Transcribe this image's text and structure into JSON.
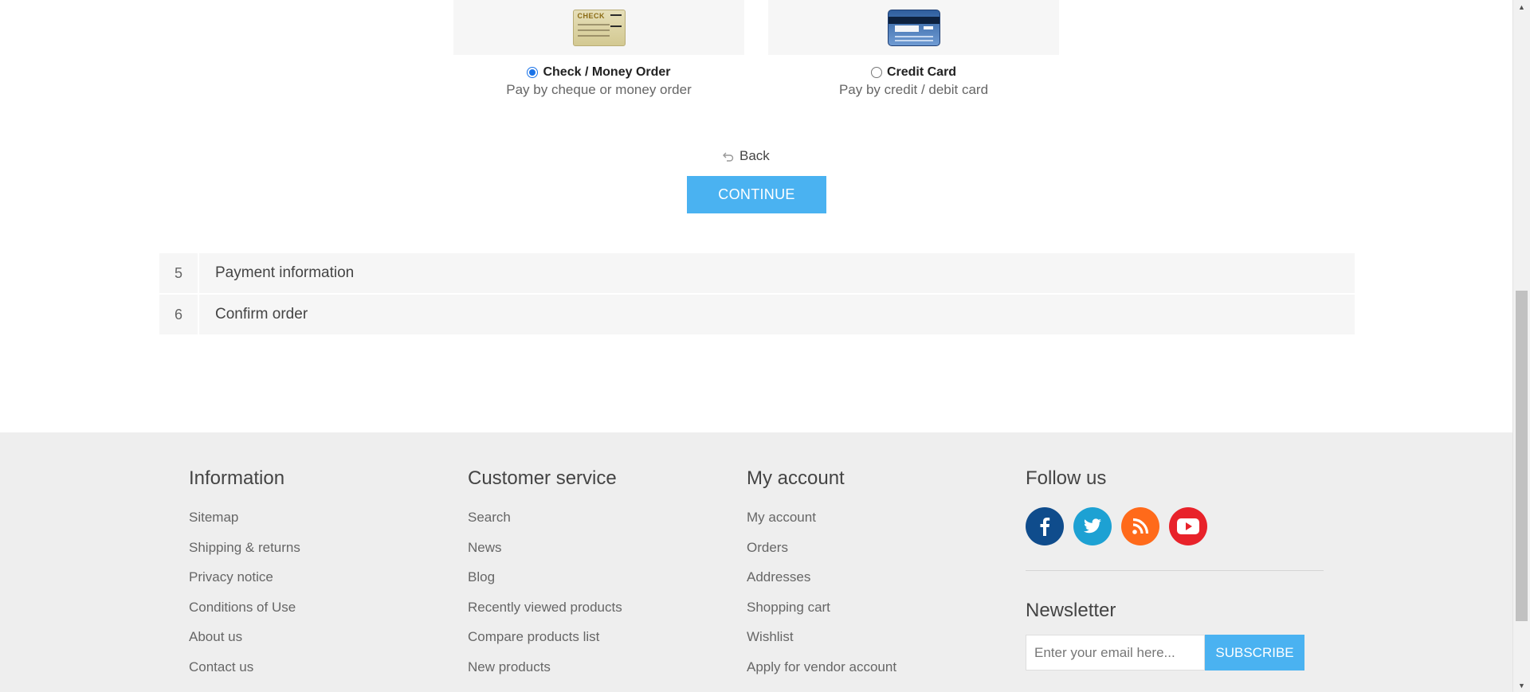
{
  "payment_methods": [
    {
      "name": "Check / Money Order",
      "description": "Pay by cheque or money order",
      "selected": true,
      "image_text": "CHECK",
      "icon": "check-image-icon"
    },
    {
      "name": "Credit Card",
      "description": "Pay by credit / debit card",
      "selected": false,
      "icon": "credit-card-image-icon"
    }
  ],
  "actions": {
    "back_label": "Back",
    "continue_label": "CONTINUE"
  },
  "steps": [
    {
      "number": "5",
      "title": "Payment information"
    },
    {
      "number": "6",
      "title": "Confirm order"
    }
  ],
  "footer": {
    "information": {
      "title": "Information",
      "links": [
        "Sitemap",
        "Shipping & returns",
        "Privacy notice",
        "Conditions of Use",
        "About us",
        "Contact us"
      ]
    },
    "customer_service": {
      "title": "Customer service",
      "links": [
        "Search",
        "News",
        "Blog",
        "Recently viewed products",
        "Compare products list",
        "New products"
      ]
    },
    "my_account": {
      "title": "My account",
      "links": [
        "My account",
        "Orders",
        "Addresses",
        "Shopping cart",
        "Wishlist",
        "Apply for vendor account"
      ]
    },
    "follow_us": {
      "title": "Follow us",
      "socials": [
        "facebook-icon",
        "twitter-icon",
        "rss-icon",
        "youtube-icon"
      ]
    },
    "newsletter": {
      "title": "Newsletter",
      "placeholder": "Enter your email here...",
      "button_label": "SUBSCRIBE"
    }
  },
  "colors": {
    "accent": "#4ab2f1",
    "footer_bg": "#eeeeee",
    "panel_bg": "#f6f6f6",
    "facebook": "#0f4c8c",
    "twitter": "#1da1d3",
    "rss": "#ff6a1a",
    "youtube": "#e8222a"
  }
}
